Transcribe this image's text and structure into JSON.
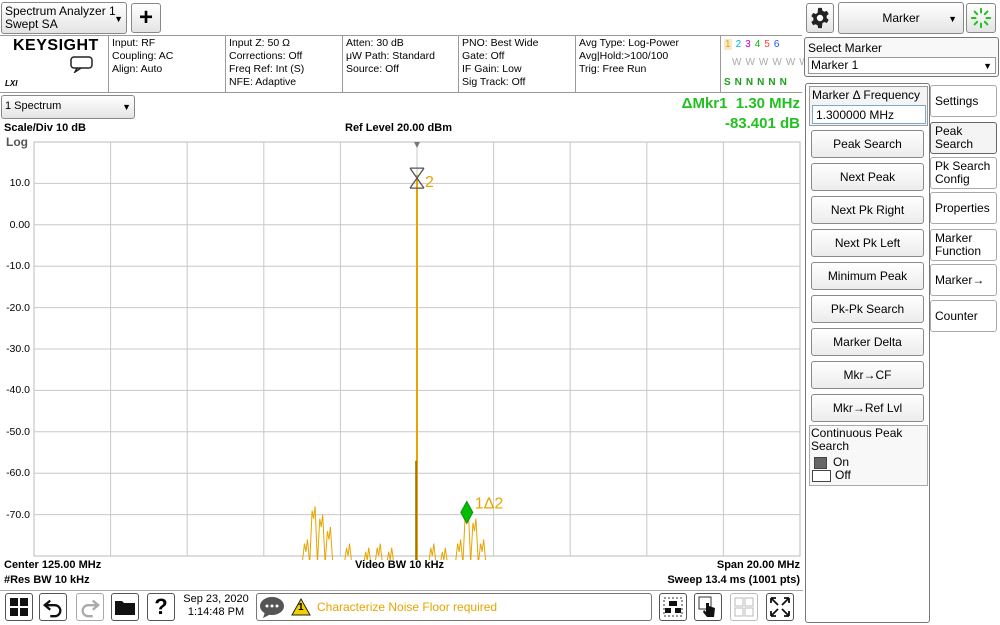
{
  "top": {
    "analyzer_line1": "Spectrum Analyzer 1",
    "analyzer_line2": "Swept SA",
    "add_symbol": "+",
    "mode_select": "Marker",
    "brand": "KEYSIGHT",
    "lxi": "LXI"
  },
  "settings": {
    "col1": [
      "Input: RF",
      "Coupling: AC",
      "Align: Auto"
    ],
    "col2": [
      "Input Z: 50 Ω",
      "Corrections: Off",
      "Freq Ref: Int (S)",
      "NFE: Adaptive"
    ],
    "col3": [
      "Atten: 30 dB",
      "μW Path: Standard",
      "Source: Off"
    ],
    "col4": [
      "PNO: Best Wide",
      "Gate: Off",
      "IF Gain: Low",
      "Sig Track: Off"
    ],
    "col5": [
      "Avg Type: Log-Power",
      "Avg|Hold:>100/100",
      "Trig: Free Run"
    ],
    "traces": [
      "1",
      "2",
      "3",
      "4",
      "5",
      "6"
    ],
    "trace_types": [
      "W",
      "W",
      "W",
      "W",
      "W",
      "W"
    ],
    "trace_det": [
      "S",
      "N",
      "N",
      "N",
      "N",
      "N"
    ],
    "trace_colors": [
      "#e8a400",
      "#00b4ff",
      "#d000d0",
      "#00c000",
      "#ff4040",
      "#2050ff"
    ]
  },
  "select_marker": {
    "label": "Select Marker",
    "value": "Marker 1"
  },
  "window": {
    "selector": "1 Spectrum"
  },
  "marker_readout": {
    "line1": "ΔMkr1  1.30 MHz",
    "line2": "-83.401 dB"
  },
  "graph": {
    "scale": "Scale/Div 10 dB",
    "ref_level": "Ref Level 20.00 dBm",
    "log": "Log",
    "y_labels": [
      "10.0",
      "0.00",
      "-10.0",
      "-20.0",
      "-30.0",
      "-40.0",
      "-50.0",
      "-60.0",
      "-70.0"
    ],
    "center": "Center 125.00 MHz",
    "res_bw": "#Res BW 10 kHz",
    "video_bw": "Video BW 10 kHz",
    "span": "Span 20.00 MHz",
    "sweep": "Sweep 13.4 ms (1001 pts)",
    "marker2_label": "2",
    "marker1_label": "1Δ2",
    "trace_color": "#e8a400",
    "marker_color": "#00c000"
  },
  "chart_data": {
    "type": "line",
    "xlabel": "",
    "ylabel": "",
    "x_range_mhz": [
      115,
      135
    ],
    "y_range_dbm": [
      20,
      -80
    ],
    "peaks": [
      {
        "x_mhz": 125.0,
        "y_dbm": 12.0
      },
      {
        "x_mhz": 126.3,
        "y_dbm": -71.4
      }
    ]
  },
  "panel": {
    "delta_freq_label": "Marker Δ Frequency",
    "delta_freq_value": "1.300000 MHz",
    "buttons": [
      "Peak Search",
      "Next Peak",
      "Next Pk Right",
      "Next Pk Left",
      "Minimum Peak",
      "Pk-Pk Search",
      "Marker Delta",
      "Mkr→CF",
      "Mkr→Ref Lvl"
    ],
    "continuous_label": "Continuous Peak Search",
    "on_label": "On",
    "off_label": "Off"
  },
  "tabs": [
    {
      "line1": "Settings",
      "line2": ""
    },
    {
      "line1": "Peak",
      "line2": "Search"
    },
    {
      "line1": "Pk Search",
      "line2": "Config"
    },
    {
      "line1": "Properties",
      "line2": ""
    },
    {
      "line1": "Marker",
      "line2": "Function"
    },
    {
      "line1": "Marker→",
      "line2": ""
    },
    {
      "line1": "Counter",
      "line2": ""
    }
  ],
  "status": {
    "date": "Sep 23, 2020",
    "time": "1:14:48 PM",
    "warning_count": "1",
    "message": "Characterize Noise Floor required",
    "message_color": "#e8a400"
  }
}
